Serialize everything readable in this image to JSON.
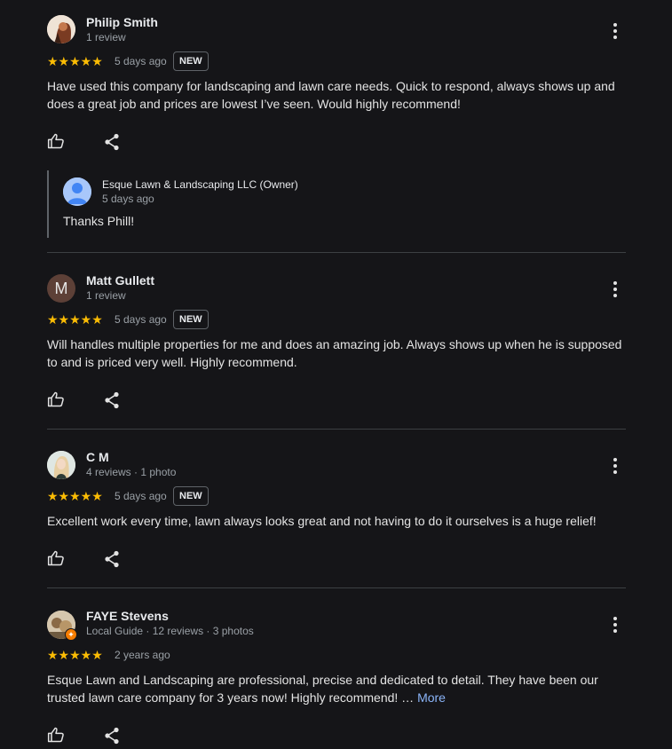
{
  "reviews": [
    {
      "name": "Philip Smith",
      "meta": "1 review",
      "stars": "★★★★★",
      "date": "5 days ago",
      "badge": "NEW",
      "text": "Have used this company for landscaping and lawn care needs. Quick to respond, always shows up and does a great job and prices are lowest I’ve seen. Would highly recommend!",
      "reply": {
        "owner": "Esque Lawn & Landscaping LLC (Owner)",
        "date": "5 days ago",
        "text": "Thanks Phill!"
      }
    },
    {
      "name": "Matt Gullett",
      "initial": "M",
      "meta": "1 review",
      "stars": "★★★★★",
      "date": "5 days ago",
      "badge": "NEW",
      "text": "Will handles multiple properties for me and does an amazing job. Always shows up when he is supposed to and is priced very well. Highly recommend."
    },
    {
      "name": "C M",
      "meta": "4 reviews · 1 photo",
      "stars": "★★★★★",
      "date": "5 days ago",
      "badge": "NEW",
      "text": "Excellent work every time, lawn always looks great and not having to do it ourselves is a huge relief!"
    },
    {
      "name": "FAYE Stevens",
      "meta": "Local Guide · 12 reviews · 3 photos",
      "stars": "★★★★★",
      "date": "2 years ago",
      "text": "Esque Lawn and Landscaping are professional, precise and dedicated to detail. They have been our trusted lawn care company for 3 years now! Highly recommend! …",
      "more_label": "More"
    }
  ],
  "colors": {
    "background": "#151518",
    "star": "#fbbc04",
    "link": "#8ab4f8",
    "divider": "#3c4043"
  },
  "icons": [
    "thumbs-up-icon",
    "share-icon",
    "more-vert-icon",
    "default-avatar-icon",
    "local-guide-badge-icon"
  ]
}
